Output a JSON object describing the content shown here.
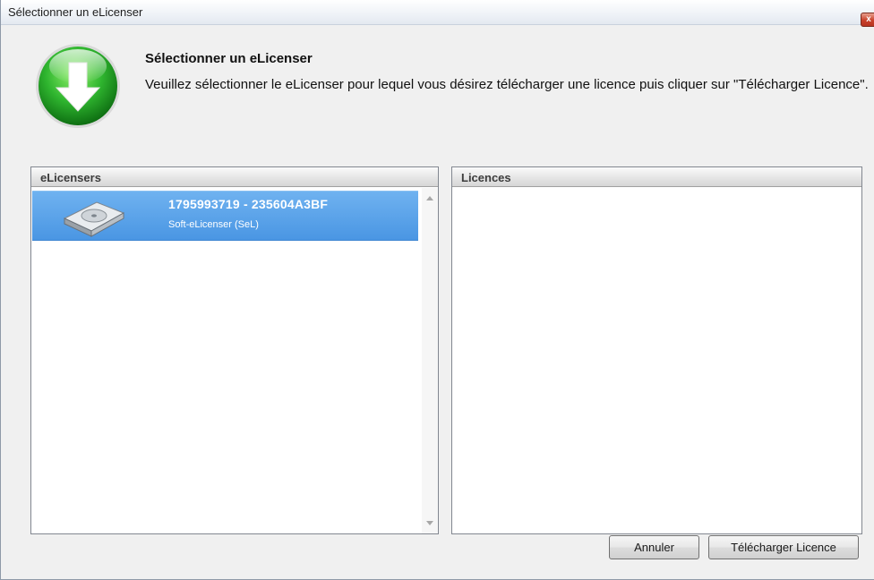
{
  "window": {
    "title": "Sélectionner un eLicenser",
    "close_label": "x"
  },
  "header": {
    "icon": "download-arrow-icon",
    "title": "Sélectionner un eLicenser",
    "description": "Veuillez sélectionner le eLicenser pour lequel vous désirez télécharger une licence puis cliquer sur \"Télécharger Licence\"."
  },
  "elicensers_panel": {
    "header": "eLicensers",
    "items": [
      {
        "icon": "hard-disk-icon",
        "title": "1795993719 - 235604A3BF",
        "subtitle": "Soft-eLicenser (SeL)",
        "selected": true
      }
    ]
  },
  "licences_panel": {
    "header": "Licences",
    "items": []
  },
  "buttons": {
    "cancel": "Annuler",
    "download": "Télécharger Licence"
  },
  "colors": {
    "selection": "#4a96e3",
    "icon_green": "#2fb52f",
    "window_bg": "#f0f0f0"
  }
}
